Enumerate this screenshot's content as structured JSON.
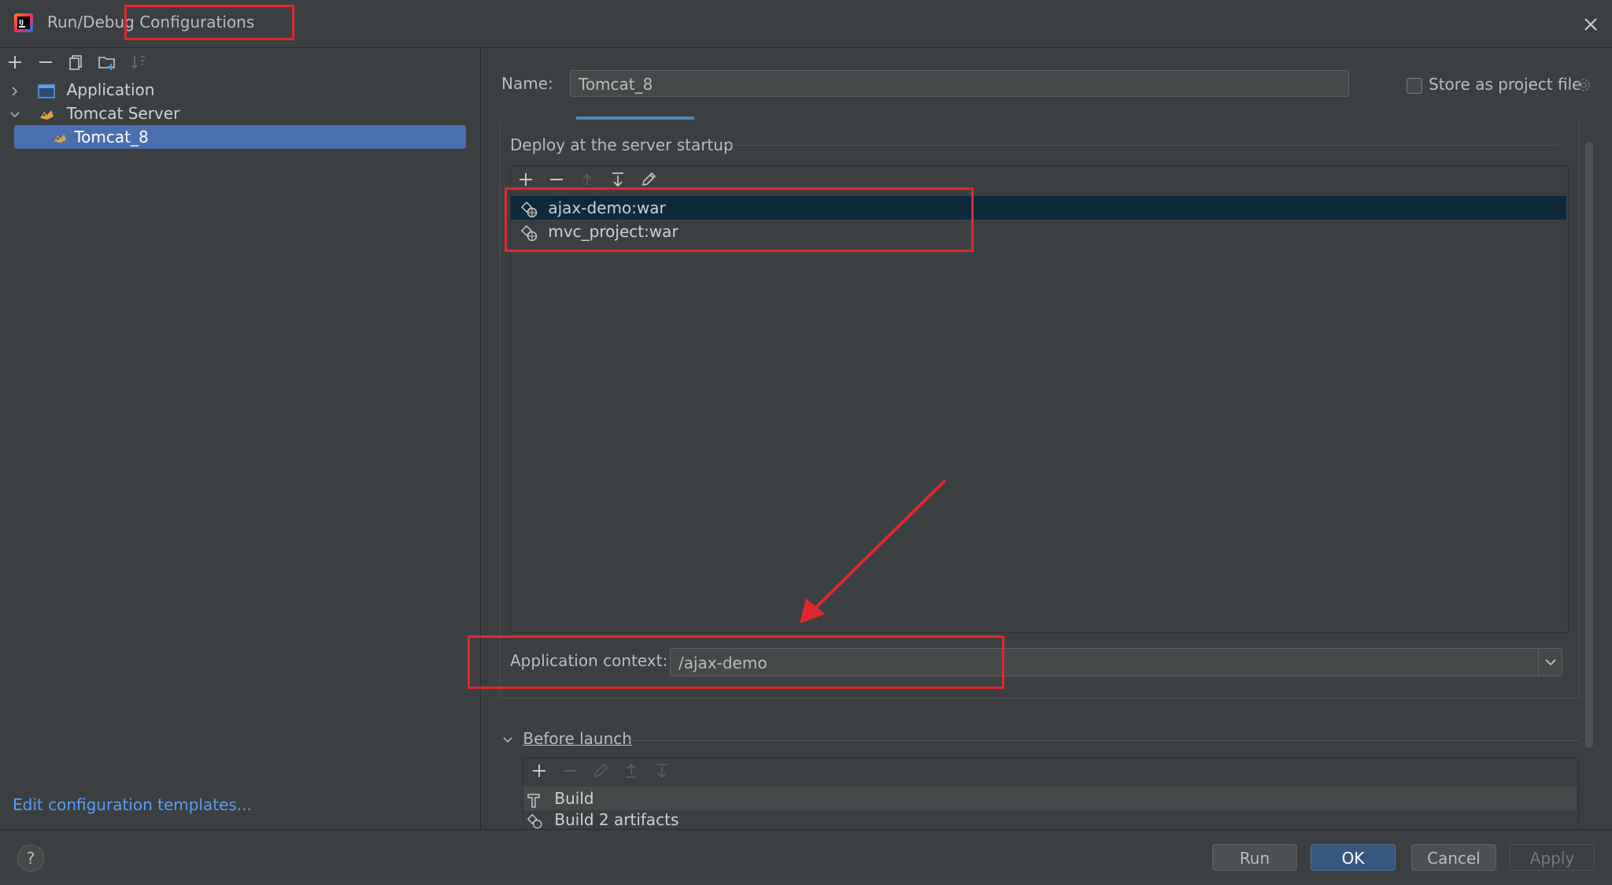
{
  "window": {
    "title": "Run/Debug Configurations"
  },
  "toolbar": {
    "add": "add",
    "remove": "remove",
    "copy": "copy",
    "folder": "new-folder",
    "sort": "sort"
  },
  "tree": {
    "items": [
      {
        "label": "Application",
        "expanded": false,
        "icon": "application-icon"
      },
      {
        "label": "Tomcat Server",
        "expanded": true,
        "icon": "tomcat-icon"
      },
      {
        "label": "Tomcat_8",
        "selected": true,
        "icon": "tomcat-icon"
      }
    ]
  },
  "left_footer": {
    "edit_templates": "Edit configuration templates..."
  },
  "form": {
    "name_label": "Name:",
    "name_value": "Tomcat_8",
    "store_label": "Store as project file",
    "store_checked": false
  },
  "deploy": {
    "title": "Deploy at the server startup",
    "artifacts": [
      "ajax-demo:war",
      "mvc_project:war"
    ],
    "context_label": "Application context:",
    "context_value": "/ajax-demo"
  },
  "before_launch": {
    "title": "Before launch",
    "items": [
      "Build",
      "Build 2 artifacts"
    ]
  },
  "buttons": {
    "help": "?",
    "run": "Run",
    "ok": "OK",
    "cancel": "Cancel",
    "apply": "Apply"
  },
  "colors": {
    "background": "#3c3f41",
    "selection": "#4b6eaf",
    "accent": "#4a88c7",
    "annotation": "#e0272f"
  }
}
